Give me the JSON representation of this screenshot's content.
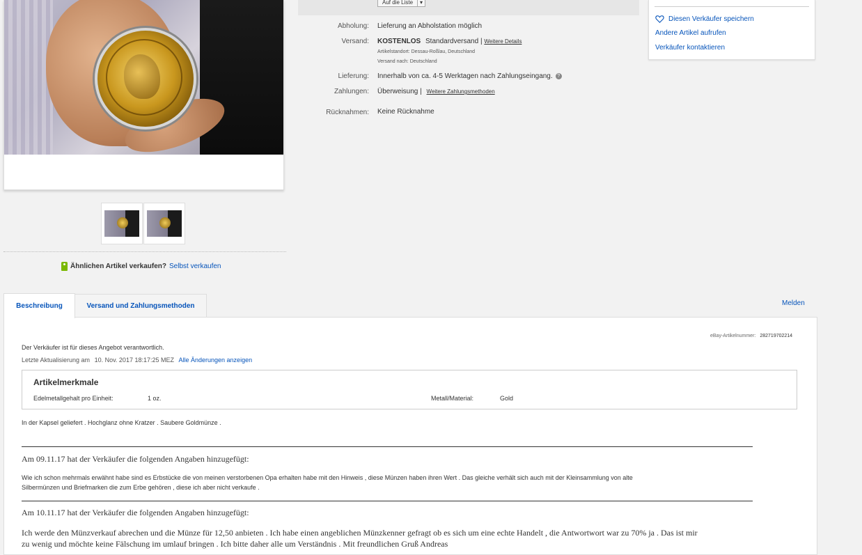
{
  "watch_button": {
    "label": "Auf die Liste"
  },
  "details": {
    "pickup": {
      "label": "Abholung:",
      "value": "Lieferung an Abholstation möglich"
    },
    "shipping": {
      "label": "Versand:",
      "free": "KOSTENLOS",
      "method": "Standardversand |",
      "link": "Weitere Details",
      "location": "Artikelstandort:  Dessau-Roßlau, Deutschland",
      "ships_to": "Versand nach:  Deutschland"
    },
    "delivery": {
      "label": "Lieferung:",
      "value": "Innerhalb von ca. 4-5 Werktagen nach Zahlungseingang."
    },
    "payment": {
      "label": "Zahlungen:",
      "value": "Überweisung  |",
      "link": "Weitere Zahlungsmethoden"
    },
    "returns": {
      "label": "Rücknahmen:",
      "value": "Keine Rücknahme"
    }
  },
  "seller": {
    "save": "Diesen Verkäufer speichern",
    "other_items": "Andere Artikel aufrufen",
    "contact": "Verkäufer kontaktieren"
  },
  "sell_similar": {
    "question": "Ähnlichen Artikel verkaufen?",
    "link": "Selbst verkaufen"
  },
  "tabs": [
    {
      "label": "Beschreibung"
    },
    {
      "label": "Versand und Zahlungsmethoden"
    }
  ],
  "report": "Melden",
  "description": {
    "item_number_label": "eBay-Artikelnummer:",
    "item_number": "282719702214",
    "responsibility": "Der Verkäufer ist für dieses Angebot verantwortlich.",
    "last_update_label": "Letzte Aktualisierung am",
    "last_update": "10. Nov. 2017 18:17:25 MEZ",
    "all_changes": "Alle Änderungen anzeigen",
    "specs_title": "Artikelmerkmale",
    "specs": [
      {
        "key": "Edelmetallgehalt pro Einheit:",
        "value": "1 oz."
      },
      {
        "key": "Metall/Material:",
        "value": "Gold"
      }
    ],
    "text1": "In der Kapsel geliefert . Hochglanz ohne Kratzer . Saubere Goldmünze .",
    "add1_heading": "Am 09.11.17 hat der Verkäufer die folgenden Angaben hinzugefügt:",
    "add1_line1": "Wie ich schon mehrmals erwähnt habe sind es Erbstücke die von meinen verstorbenen Opa erhalten habe mit den Hinweis , diese Münzen haben ihren Wert . Das gleiche verhält sich auch mit der Kleinsammlung von alte",
    "add1_line2": "Silbermünzen und Briefmarken die zum Erbe gehören , diese ich aber nicht verkaufe .",
    "add2_heading": "Am 10.11.17 hat der Verkäufer die folgenden Angaben hinzugefügt:",
    "add2_line1": "Ich werde den Münzverkauf abrechen und die Münze für 12,50 anbieten . Ich habe einen angeblichen Münzkenner gefragt ob es sich um eine echte Handelt , die Antwortwort war zu 70% ja . Das ist mir",
    "add2_line2": "zu wenig und möchte keine Fälschung im umlauf bringen . Ich bitte daher alle um Verständnis .        Mit freundlichen Gruß Andreas"
  },
  "colors": {
    "link": "#0654ba",
    "accent_tag": "#7ab800"
  }
}
